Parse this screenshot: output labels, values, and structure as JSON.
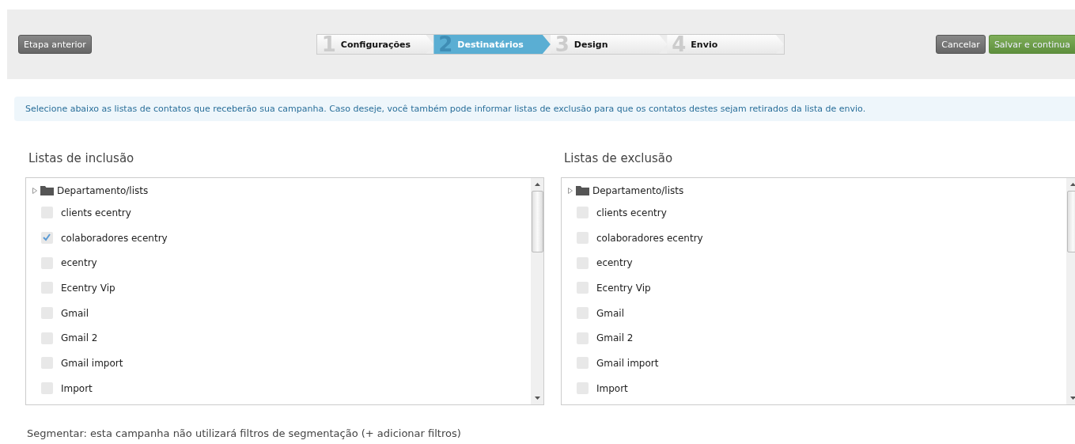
{
  "toolbar": {
    "back_button": "Etapa anterior",
    "steps": [
      {
        "number": "1",
        "label": "Configurações",
        "selected": false
      },
      {
        "number": "2",
        "label": "Destinatários",
        "selected": true
      },
      {
        "number": "3",
        "label": "Design",
        "selected": false
      },
      {
        "number": "4",
        "label": "Envio",
        "selected": false
      }
    ],
    "cancel_button": "Cancelar",
    "save_button": "Salvar e continua"
  },
  "info": "Selecione abaixo as listas de contatos que receberão sua campanha. Caso deseje, você também pode informar listas de exclusão para que os contatos destes sejam retirados da lista de envio.",
  "panels": [
    {
      "title": "Listas de inclusão",
      "tree": [
        {
          "label": "Departamento/lists",
          "children": [
            {
              "label": "clients ecentry",
              "checked": false
            },
            {
              "label": "colaboradores ecentry",
              "checked": true
            },
            {
              "label": "ecentry",
              "checked": false
            },
            {
              "label": "Ecentry Vip",
              "checked": false
            },
            {
              "label": "Gmail",
              "checked": false
            },
            {
              "label": "Gmail 2",
              "checked": false
            },
            {
              "label": "Gmail import",
              "checked": false
            },
            {
              "label": "Import",
              "checked": false
            }
          ]
        }
      ]
    },
    {
      "title": "Listas de exclusão",
      "tree": [
        {
          "label": "Departamento/lists",
          "children": [
            {
              "label": "clients ecentry",
              "checked": false
            },
            {
              "label": "colaboradores ecentry",
              "checked": false
            },
            {
              "label": "ecentry",
              "checked": false
            },
            {
              "label": "Ecentry Vip",
              "checked": false
            },
            {
              "label": "Gmail",
              "checked": false
            },
            {
              "label": "Gmail 2",
              "checked": false
            },
            {
              "label": "Gmail import",
              "checked": false
            },
            {
              "label": "Import",
              "checked": false
            }
          ]
        }
      ]
    }
  ],
  "segment_text": "Segmentar: esta campanha não utilizará filtros de segmentação (+ adicionar filtros)"
}
